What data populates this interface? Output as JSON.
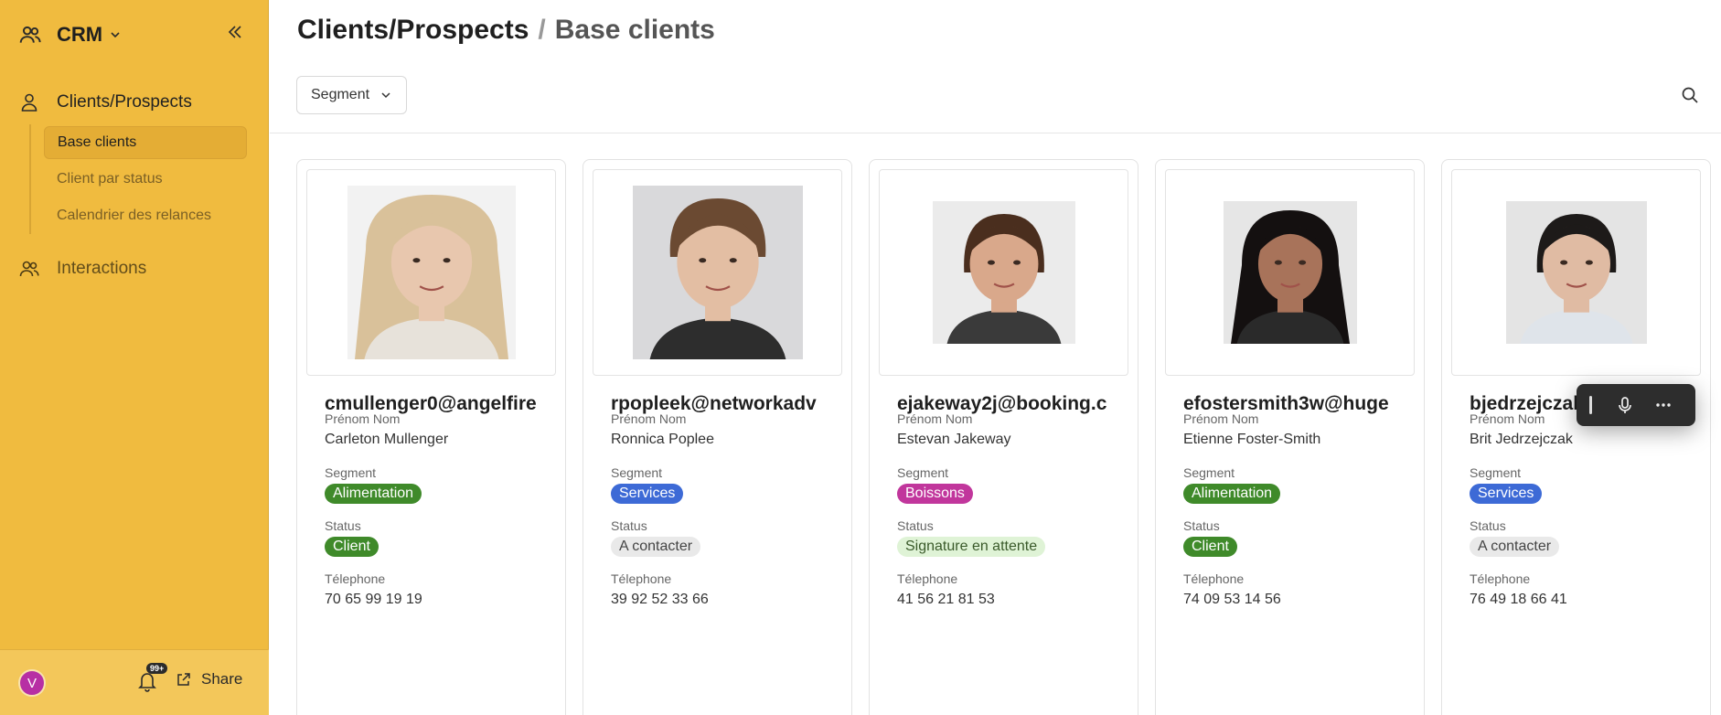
{
  "sidebar": {
    "app_name": "CRM",
    "nav": [
      {
        "label": "Clients/Prospects",
        "icon": "user-icon"
      },
      {
        "label": "Interactions",
        "icon": "users-icon"
      }
    ],
    "subnav": [
      {
        "label": "Base clients",
        "active": true
      },
      {
        "label": "Client par status",
        "active": false
      },
      {
        "label": "Calendrier des relances",
        "active": false
      }
    ],
    "footer": {
      "avatar_initial": "V",
      "notifications_badge": "99+",
      "share_label": "Share"
    }
  },
  "header": {
    "breadcrumb_parent": "Clients/Prospects",
    "breadcrumb_separator": "/",
    "breadcrumb_current": "Base clients",
    "filter_label": "Segment"
  },
  "field_labels": {
    "name": "Prénom Nom",
    "segment": "Segment",
    "status": "Status",
    "phone": "Télephone"
  },
  "cards": [
    {
      "email": "cmullenger0@angelfire",
      "name": "Carleton Mullenger",
      "segment": "Alimentation",
      "status": "Client",
      "phone": "70 65 99 19 19"
    },
    {
      "email": "rpopleek@networkadv",
      "name": "Ronnica Poplee",
      "segment": "Services",
      "status": "A contacter",
      "phone": "39 92 52 33 66"
    },
    {
      "email": "ejakeway2j@booking.c",
      "name": "Estevan Jakeway",
      "segment": "Boissons",
      "status": "Signature en attente",
      "phone": "41 56 21 81 53"
    },
    {
      "email": "efostersmith3w@huge",
      "name": "Etienne Foster-Smith",
      "segment": "Alimentation",
      "status": "Client",
      "phone": "74 09 53 14 56"
    },
    {
      "email": "bjedrzejczak",
      "name": "Brit Jedrzejczak",
      "segment": "Services",
      "status": "A contacter",
      "phone": "76 49 18 66 41"
    }
  ],
  "segment_colors": {
    "Alimentation": {
      "bg": "#3f8a2a",
      "fg": "#ffffff"
    },
    "Services": {
      "bg": "#3d6ad6",
      "fg": "#ffffff"
    },
    "Boissons": {
      "bg": "#c1369c",
      "fg": "#ffffff"
    }
  },
  "status_colors": {
    "Client": {
      "bg": "#3f8a2a",
      "fg": "#ffffff"
    },
    "A contacter": {
      "bg": "#e9e9e9",
      "fg": "#444444"
    },
    "Signature en attente": {
      "bg": "#dff3d6",
      "fg": "#3a5a2a"
    }
  },
  "colors": {
    "sidebar_bg": "#f0bb3f",
    "accent": "#c1369c"
  }
}
